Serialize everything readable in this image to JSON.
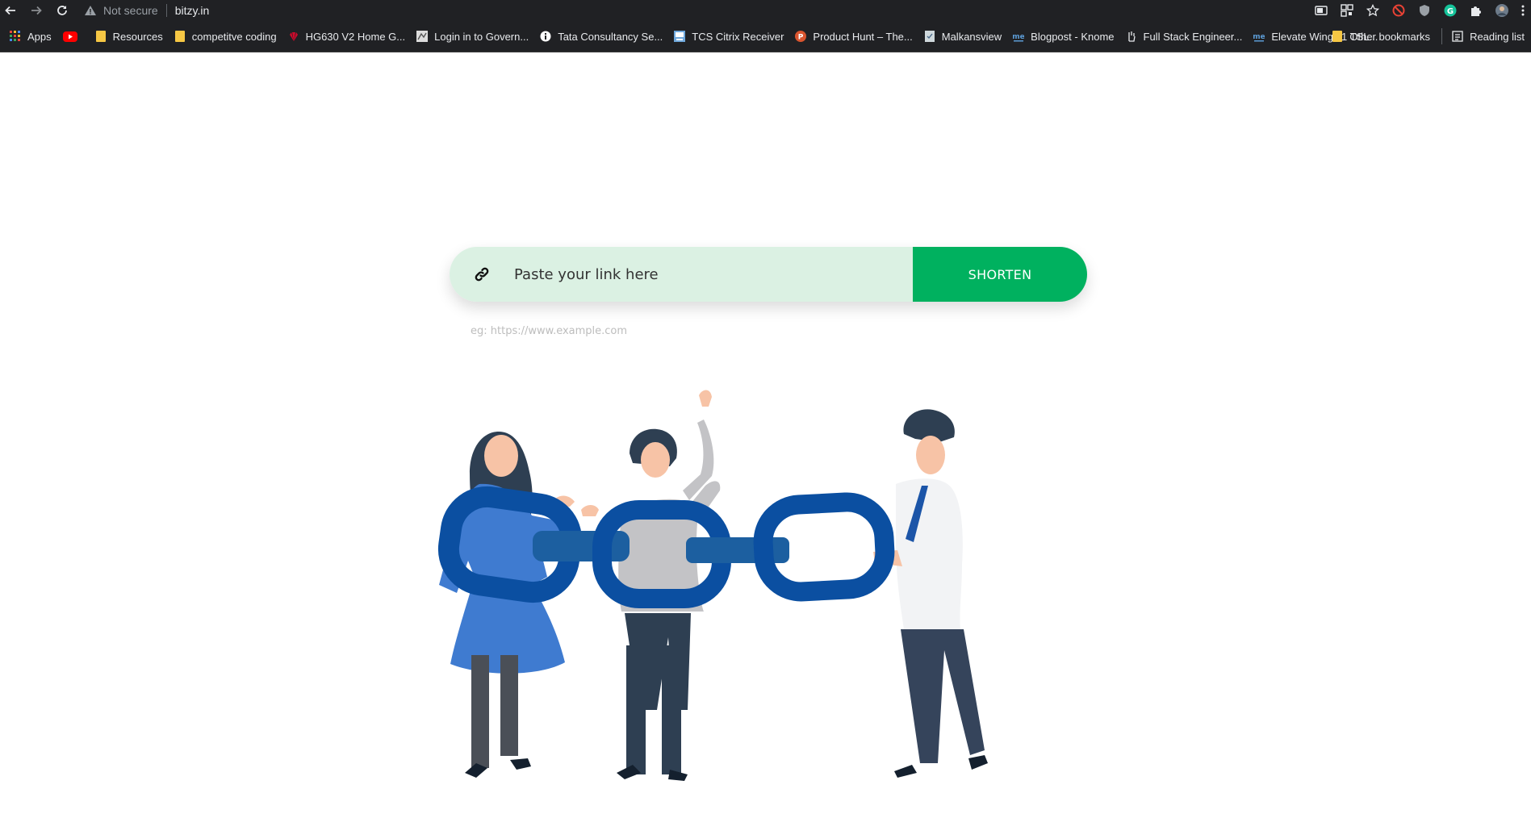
{
  "browser": {
    "back_icon": "arrow-left-icon",
    "forward_icon": "arrow-right-icon",
    "reload_icon": "reload-icon",
    "security_label": "Not secure",
    "url": "bitzy.in",
    "right_icons": [
      "cast-icon",
      "qr-icon",
      "star-icon",
      "blocker-extension-icon",
      "shield-extension-icon",
      "grammarly-icon",
      "puzzle-icon",
      "avatar",
      "menu-icon"
    ]
  },
  "bookmarks": {
    "items": [
      {
        "label": "Apps",
        "icon": "apps-grid-icon",
        "color": "#e8453c"
      },
      {
        "label": "",
        "icon": "youtube-icon",
        "color": "#ff0000"
      },
      {
        "label": "Resources",
        "icon": "folder-icon",
        "color": "#f6c744"
      },
      {
        "label": "competitve coding",
        "icon": "folder-icon",
        "color": "#f6c744"
      },
      {
        "label": "HG630 V2 Home G...",
        "icon": "huawei-icon",
        "color": "#cf0a2c"
      },
      {
        "label": "Login in to Govern...",
        "icon": "gov-site-icon",
        "color": "#dddddd"
      },
      {
        "label": "Tata Consultancy Se...",
        "icon": "info-icon",
        "color": "#ffffff"
      },
      {
        "label": "TCS Citrix Receiver",
        "icon": "citrix-icon",
        "color": "#6fa8dc"
      },
      {
        "label": "Product Hunt – The...",
        "icon": "producthunt-icon",
        "color": "#da552f"
      },
      {
        "label": "Malkansview",
        "icon": "doc-icon",
        "color": "#cfd8dc"
      },
      {
        "label": "Blogpost - Knome",
        "icon": "knome-icon",
        "color": "#5b9bd5"
      },
      {
        "label": "Full Stack Engineer...",
        "icon": "hand-icon",
        "color": "#e8eaed"
      },
      {
        "label": "Elevate Wings 1 TSL...",
        "icon": "knome-icon",
        "color": "#5b9bd5"
      }
    ],
    "other_label": "Other bookmarks",
    "reading_list_label": "Reading list"
  },
  "main": {
    "input_placeholder": "Paste your link here",
    "input_value": "",
    "button_label": "SHORTEN",
    "example_hint": "eg: https://www.example.com",
    "link_icon": "link-icon",
    "illustration": "people-holding-chain-illustration"
  },
  "colors": {
    "accent": "#00b15f",
    "field_bg": "#dbf1e3",
    "chain": "#0b4fa1"
  }
}
